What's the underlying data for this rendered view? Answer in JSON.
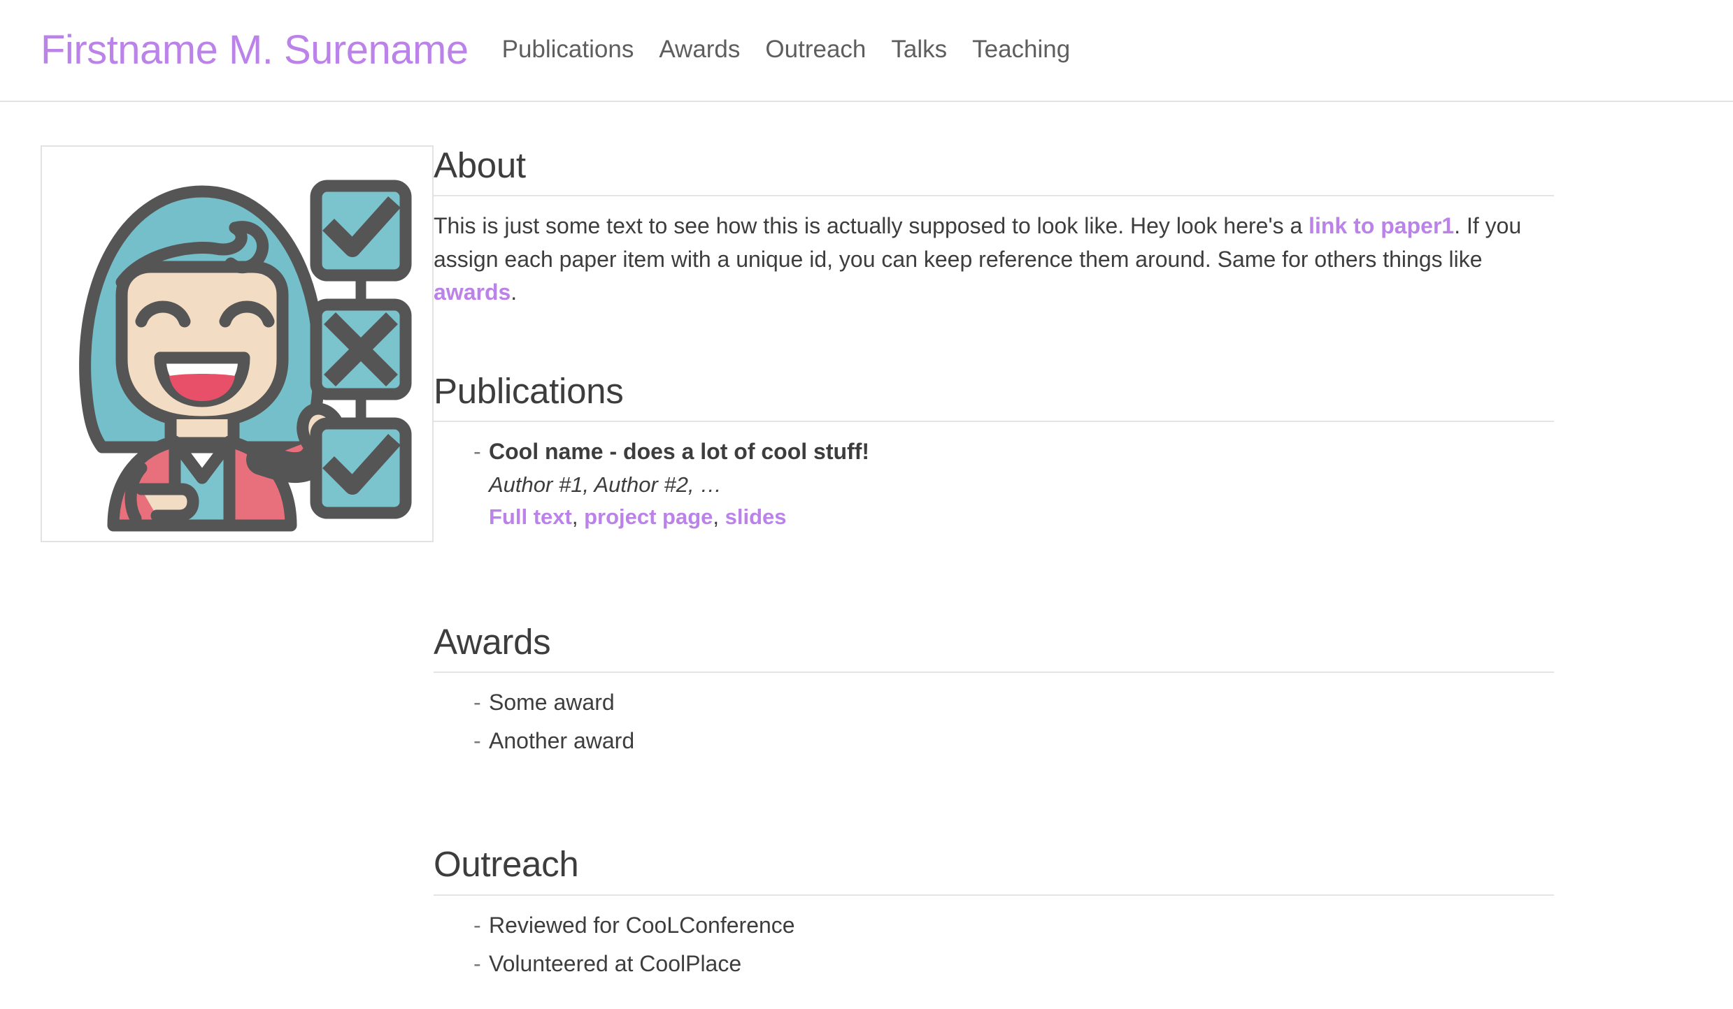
{
  "header": {
    "site_title": "Firstname M. Surename",
    "nav": [
      {
        "label": "Publications"
      },
      {
        "label": "Awards"
      },
      {
        "label": "Outreach"
      },
      {
        "label": "Talks"
      },
      {
        "label": "Teaching"
      }
    ]
  },
  "avatar": {
    "alt": "Illustration of a smiling woman with teal hair in a pink jacket pointing at a vertical checklist",
    "colors": {
      "hair": "#74bfc9",
      "skin": "#f2dcc3",
      "jacket": "#e8707d",
      "mouth": "#e8506a",
      "outline": "#555555",
      "checkbox_fill": "#7bc4ce",
      "frame_border": "#e2e2e2"
    },
    "checklist": [
      {
        "state": "checked",
        "icon": "check-icon"
      },
      {
        "state": "crossed",
        "icon": "cross-icon"
      },
      {
        "state": "checked",
        "icon": "check-icon"
      }
    ]
  },
  "sections": {
    "about": {
      "heading": "About",
      "text_part1": "This is just some text to see how this is actually supposed to look like. Hey look here's a ",
      "link1": "link to paper1",
      "text_part2": ". If you assign each paper item with a unique id, you can keep reference them around. Same for others things like ",
      "link2": "awards",
      "text_part3": "."
    },
    "publications": {
      "heading": "Publications",
      "items": [
        {
          "title": "Cool name - does a lot of cool stuff!",
          "authors": "Author #1, Author #2, …",
          "links": [
            {
              "label": "Full text"
            },
            {
              "label": "project page"
            },
            {
              "label": "slides"
            }
          ],
          "link_separator": ", "
        }
      ]
    },
    "awards": {
      "heading": "Awards",
      "items": [
        {
          "label": "Some award"
        },
        {
          "label": "Another award"
        }
      ]
    },
    "outreach": {
      "heading": "Outreach",
      "items": [
        {
          "label": "Reviewed for CooLConference"
        },
        {
          "label": "Volunteered at CoolPlace"
        }
      ]
    }
  },
  "theme": {
    "accent": "#bb82ea",
    "text": "#3d3d3d",
    "rule": "#e4e4e4",
    "background": "#ffffff"
  }
}
